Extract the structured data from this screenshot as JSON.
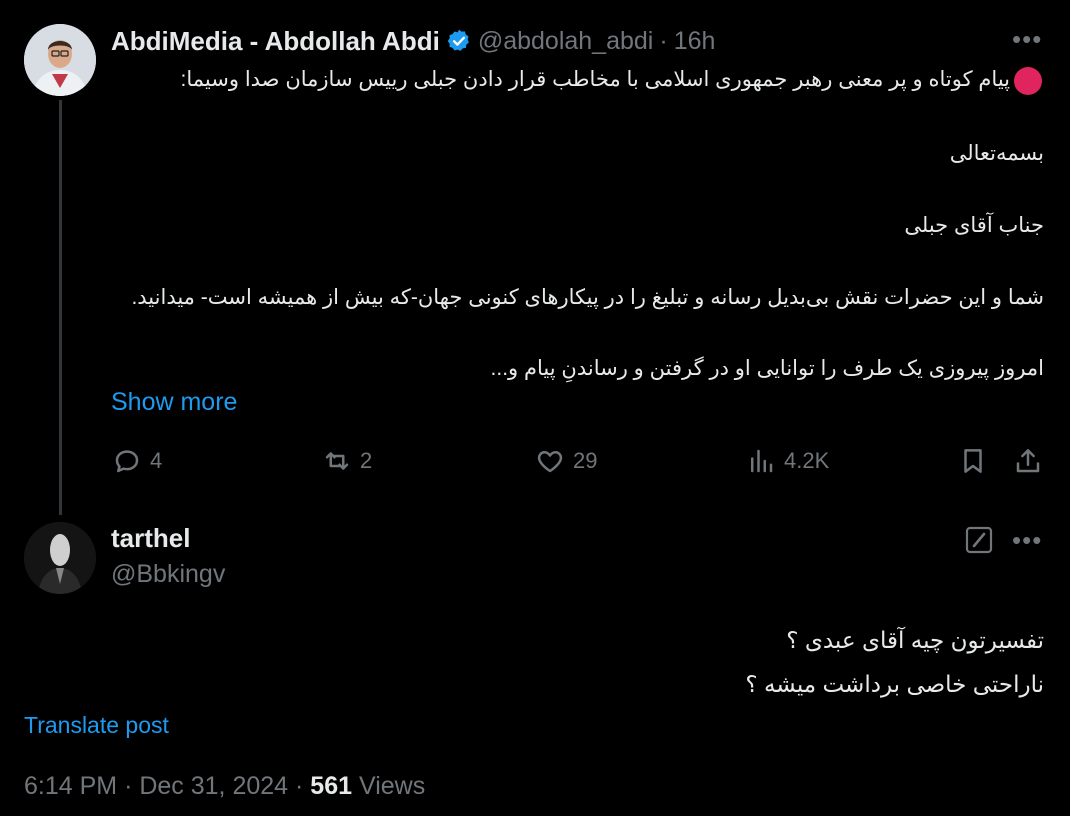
{
  "original_post": {
    "display_name": "AbdiMedia - Abdollah Abdi",
    "handle": "@abdolah_abdi",
    "separator": "·",
    "time": "16h",
    "more_icon": "more-horizontal-icon",
    "lines": [
      "پیام کوتاه و پر معنی رهبر جمهوری اسلامی با مخاطب قرار دادن جبلی رییس سازمان صدا وسیما:",
      "بسمه‌تعالی",
      "جناب آقای جبلی",
      "شما و این حضرات نقش بی‌بدیل رسانه و تبلیغ را در پیکارهای کنونی جهان-که بیش از همیشه است- میدانید.",
      "امروز پیروزی یک طرف را توانایی او در گرفتن و رساندنِ پیام و..."
    ],
    "show_more": "Show more",
    "actions": {
      "replies": "4",
      "reposts": "2",
      "likes": "29",
      "views": "4.2K"
    },
    "colors": {
      "verified": "#1d9bf0",
      "bullet": "#e0245e"
    }
  },
  "reply": {
    "display_name": "tarthel",
    "handle": "@Bbkingv",
    "lines": [
      "تفسیرتون چیه  آقای عبدی  ؟",
      "ناراحتی خاصی  برداشت میشه ؟"
    ],
    "translate_label": "Translate post",
    "footer": {
      "time": "6:14 PM",
      "dot1": "·",
      "date": "Dec 31, 2024",
      "dot2": "·",
      "views_count": "561",
      "views_label": "Views"
    }
  },
  "colors": {
    "background": "#000000",
    "text": "#e7e9ea",
    "muted": "#71767b",
    "link": "#1d9bf0"
  }
}
